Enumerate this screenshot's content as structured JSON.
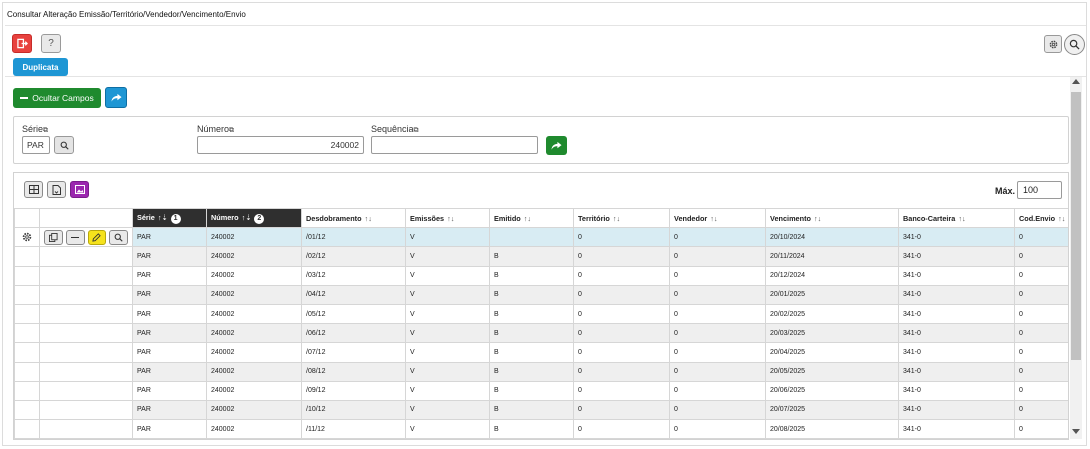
{
  "window": {
    "title": "Consultar Alteração Emissão/Território/Vendedor/Vencimento/Envio"
  },
  "toolbar": {
    "help_label": "?",
    "duplicate_label": "Duplicata"
  },
  "actions": {
    "hide_fields_label": "Ocultar Campos"
  },
  "filters": {
    "serie_label": "Série",
    "serie_value": "PAR",
    "numero_label": "Número",
    "numero_value": "240002",
    "sequencia_label": "Sequência",
    "sequencia_value": ""
  },
  "grid": {
    "max_label": "Máx.",
    "max_value": "100",
    "columns": [
      {
        "label": "Série",
        "badge": "1"
      },
      {
        "label": "Número",
        "badge": "2"
      },
      {
        "label": "Desdobramento"
      },
      {
        "label": "Emissões"
      },
      {
        "label": "Emitido"
      },
      {
        "label": "Território"
      },
      {
        "label": "Vendedor"
      },
      {
        "label": "Vencimento"
      },
      {
        "label": "Banco-Carteira"
      },
      {
        "label": "Cod.Envio"
      }
    ],
    "rows": [
      [
        "PAR",
        "240002",
        "/01/12",
        "V",
        "",
        "0",
        "0",
        "20/10/2024",
        "341-0",
        "0"
      ],
      [
        "PAR",
        "240002",
        "/02/12",
        "V",
        "B",
        "0",
        "0",
        "20/11/2024",
        "341-0",
        "0"
      ],
      [
        "PAR",
        "240002",
        "/03/12",
        "V",
        "B",
        "0",
        "0",
        "20/12/2024",
        "341-0",
        "0"
      ],
      [
        "PAR",
        "240002",
        "/04/12",
        "V",
        "B",
        "0",
        "0",
        "20/01/2025",
        "341-0",
        "0"
      ],
      [
        "PAR",
        "240002",
        "/05/12",
        "V",
        "B",
        "0",
        "0",
        "20/02/2025",
        "341-0",
        "0"
      ],
      [
        "PAR",
        "240002",
        "/06/12",
        "V",
        "B",
        "0",
        "0",
        "20/03/2025",
        "341-0",
        "0"
      ],
      [
        "PAR",
        "240002",
        "/07/12",
        "V",
        "B",
        "0",
        "0",
        "20/04/2025",
        "341-0",
        "0"
      ],
      [
        "PAR",
        "240002",
        "/08/12",
        "V",
        "B",
        "0",
        "0",
        "20/05/2025",
        "341-0",
        "0"
      ],
      [
        "PAR",
        "240002",
        "/09/12",
        "V",
        "B",
        "0",
        "0",
        "20/06/2025",
        "341-0",
        "0"
      ],
      [
        "PAR",
        "240002",
        "/10/12",
        "V",
        "B",
        "0",
        "0",
        "20/07/2025",
        "341-0",
        "0"
      ],
      [
        "PAR",
        "240002",
        "/11/12",
        "V",
        "B",
        "0",
        "0",
        "20/08/2025",
        "341-0",
        "0"
      ]
    ]
  },
  "colors": {
    "danger": "#e8413e",
    "primary": "#1e96d4",
    "success": "#1f8a2e",
    "purple": "#9b27af",
    "edit": "#f5e21c",
    "selected_row": "#d8ecf3",
    "header_dark": "#2f2f2f"
  }
}
